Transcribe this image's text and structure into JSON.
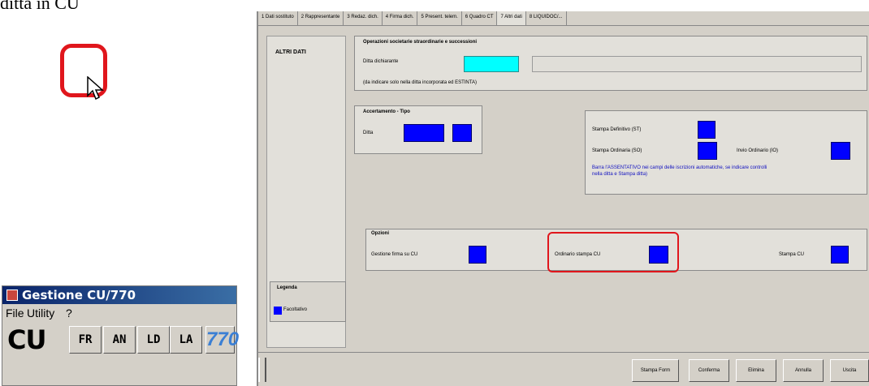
{
  "caption": "ditta in CU",
  "app": {
    "title": "Gestione CU/770",
    "menu": [
      "File",
      "Utility",
      "?"
    ],
    "toolbar": {
      "logo": "CU",
      "buttons": [
        "FR",
        "AN",
        "LD",
        "LA"
      ],
      "logo_770": "770"
    }
  },
  "main": {
    "tabs": [
      "1 Dati sostituto",
      "2 Rappresentante",
      "3 Redaz. dich.",
      "4 Firma dich.",
      "5 Present. telem.",
      "6 Quadro CT",
      "7 Altri dati",
      "8 LIQUIDOC/..."
    ],
    "active_tab": "7 Altri dati",
    "side": {
      "title": "ALTRI DATI",
      "legend_title": "Legenda",
      "legend_item": "Facoltativo"
    },
    "operazioni": {
      "title": "Operazioni societarie straordinarie e successioni",
      "ditta_label": "Ditta dichiarante",
      "note": "(da indicare solo nella ditta incorporata ed ESTINTA)"
    },
    "accertamento": {
      "title": "Accertamento - Tipo",
      "ditta_label": "Ditta"
    },
    "stampa": {
      "definitivo_label": "Stampa Definitivo (ST)",
      "ordinaria_label": "Stampa Ordinaria (SO)",
      "invio_label": "Invio Ordinario (IO)",
      "note": "Barra l'ASSENTATIVO nei campi delle iscrizioni automatiche, se indicare controlli nella ditta e Stampa ditta)"
    },
    "opzioni": {
      "title": "Opzioni",
      "gestione_label": "Gestione firma su CU",
      "ordinario_label": "Ordinario stampa CU",
      "stampa_label": "Stampa CU"
    },
    "buttons": [
      "Stampa Form",
      "Conferma",
      "Elimina",
      "Annulla",
      "Uscita"
    ]
  }
}
